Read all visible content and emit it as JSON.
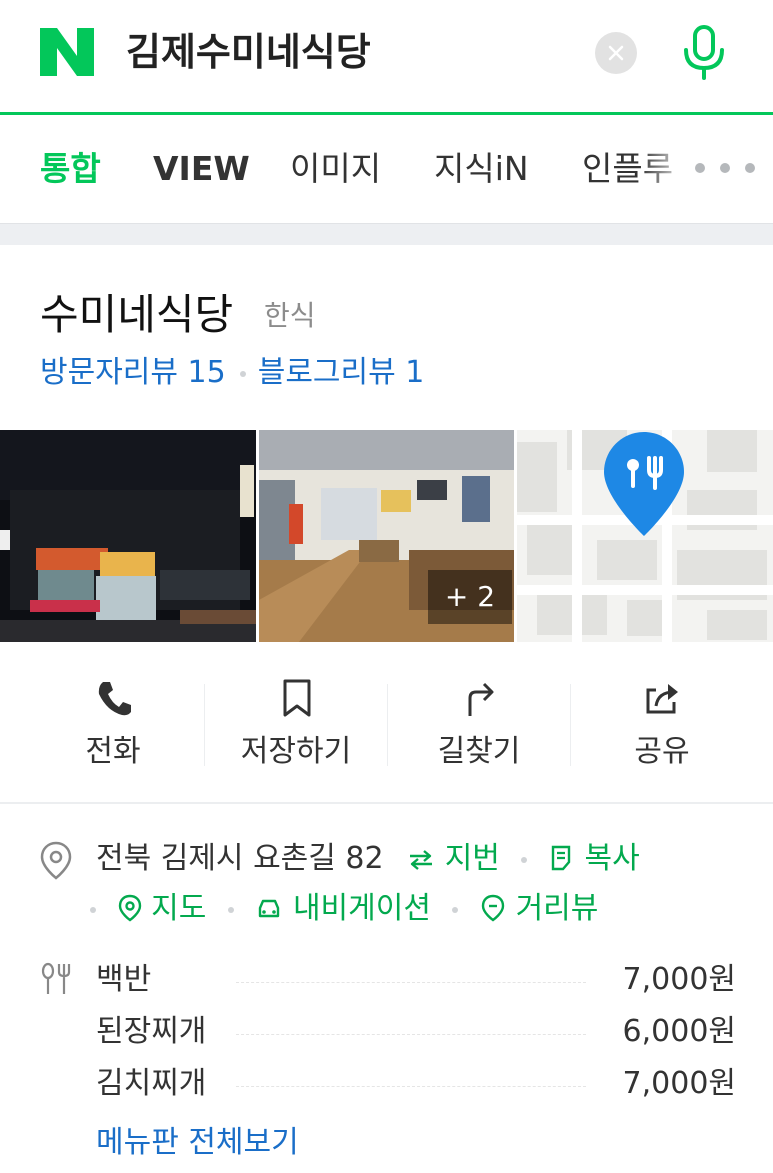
{
  "search": {
    "query": "김제수미네식당"
  },
  "tabs": [
    {
      "label": "통합",
      "active": true
    },
    {
      "label": "VIEW",
      "active": false
    },
    {
      "label": "이미지",
      "active": false
    },
    {
      "label": "지식iN",
      "active": false
    },
    {
      "label": "인플루",
      "active": false
    }
  ],
  "place": {
    "name": "수미네식당",
    "category": "한식",
    "visitor_reviews": "방문자리뷰 15",
    "blog_reviews": "블로그리뷰 1",
    "photo_more_count": "+ 2"
  },
  "actions": [
    {
      "label": "전화",
      "icon": "phone-icon"
    },
    {
      "label": "저장하기",
      "icon": "bookmark-icon"
    },
    {
      "label": "길찾기",
      "icon": "directions-icon"
    },
    {
      "label": "공유",
      "icon": "share-icon"
    }
  ],
  "address": {
    "text": "전북 김제시 요촌길 82",
    "lot_number_label": "지번",
    "copy_label": "복사",
    "map_label": "지도",
    "navigation_label": "내비게이션",
    "street_view_label": "거리뷰"
  },
  "menu": {
    "items": [
      {
        "name": "백반",
        "price": "7,000원"
      },
      {
        "name": "된장찌개",
        "price": "6,000원"
      },
      {
        "name": "김치찌개",
        "price": "7,000원"
      }
    ],
    "more_label": "메뉴판 전체보기"
  },
  "colors": {
    "brand_green": "#03c75a",
    "link_blue": "#1a6ec8",
    "map_pin_blue": "#1e88e5"
  }
}
